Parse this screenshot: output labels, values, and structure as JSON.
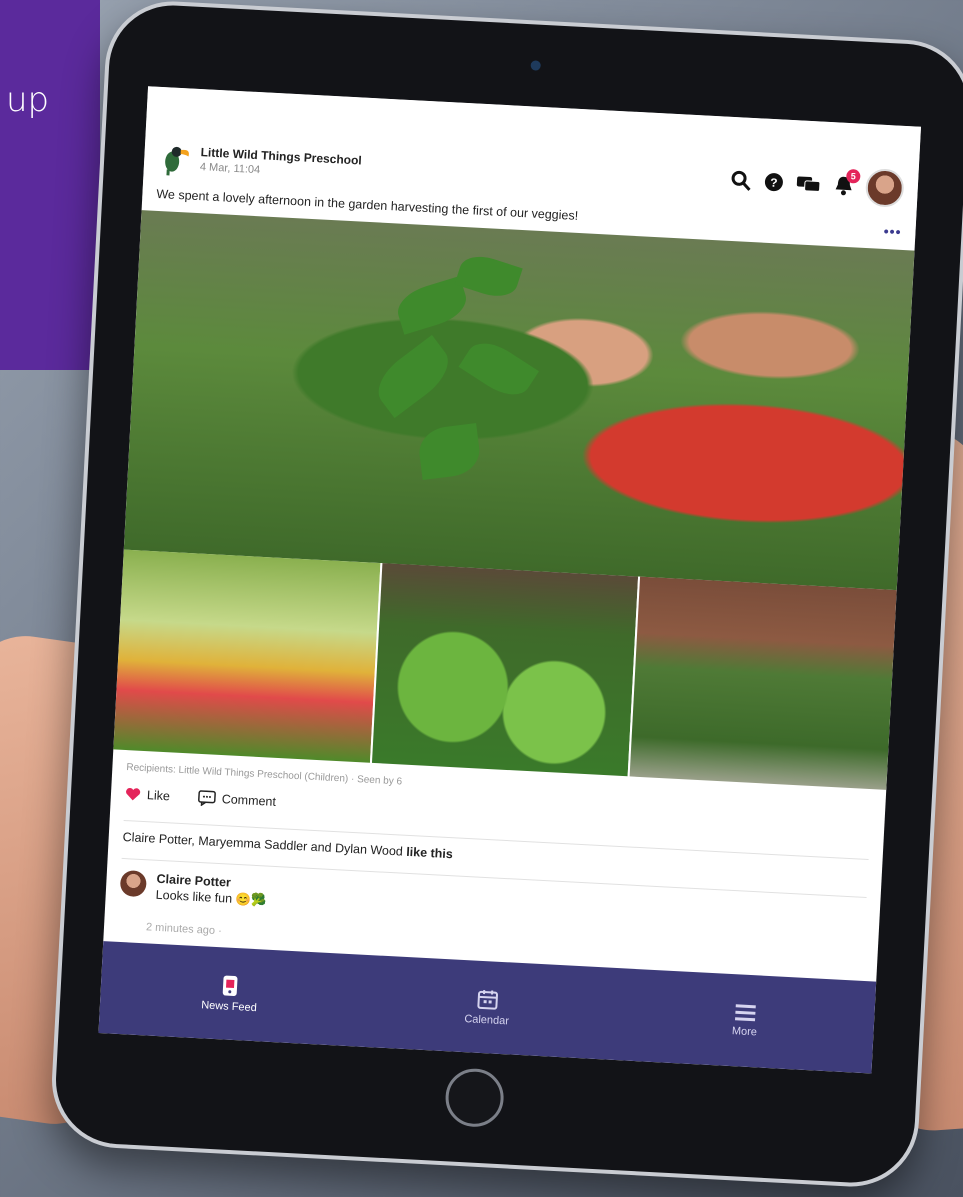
{
  "banner": {
    "text": "up"
  },
  "post": {
    "org_name": "Little Wild Things Preschool",
    "time": "4 Mar, 11:04",
    "caption": "We spent a lovely afternoon in the garden harvesting the first of our veggies!",
    "more_label": "•••",
    "recipients": "Recipients: Little Wild Things Preschool (Children) · Seen by 6",
    "like_label": "Like",
    "comment_label": "Comment",
    "likers_names": "Claire Potter, Maryemma Saddler and Dylan Wood",
    "likers_suffix": "like this"
  },
  "notifications": {
    "count": "5"
  },
  "comment": {
    "author": "Claire Potter",
    "text": "Looks like fun 😊🥦",
    "time": "2 minutes ago ·"
  },
  "nav": {
    "items": [
      {
        "label": "News Feed",
        "icon": "phone-icon"
      },
      {
        "label": "Calendar",
        "icon": "calendar-icon"
      },
      {
        "label": "More",
        "icon": "menu-icon"
      }
    ]
  },
  "colors": {
    "nav_bg": "#3d3b7a",
    "like_heart": "#e4245a",
    "banner": "#5b2a9c"
  }
}
